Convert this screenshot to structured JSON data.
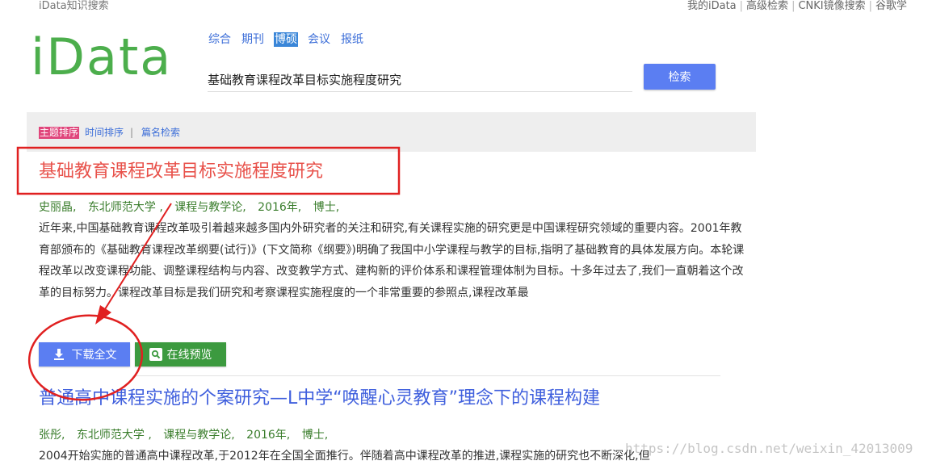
{
  "topbar": {
    "site_name": "iData知识搜索",
    "links": [
      "我的iData",
      "高级检索",
      "CNKI镜像搜索",
      "谷歌学"
    ]
  },
  "logo": {
    "text": "iData"
  },
  "tabs": [
    {
      "label": "综合",
      "active": false
    },
    {
      "label": "期刊",
      "active": false
    },
    {
      "label": "博硕",
      "active": true
    },
    {
      "label": "会议",
      "active": false
    },
    {
      "label": "报纸",
      "active": false
    }
  ],
  "search": {
    "value": "基础教育课程改革目标实施程度研究",
    "button_label": "检索"
  },
  "sort": {
    "topic": "主题排序",
    "time": "时间排序",
    "separator": "|",
    "title": "篇名检索"
  },
  "results": [
    {
      "title": "基础教育课程改革目标实施程度研究",
      "author": "史丽晶,",
      "school": "东北师范大学 ,",
      "subject": "课程与教学论,",
      "year": "2016年,",
      "degree": "博士,",
      "abstract": "近年来,中国基础教育课程改革吸引着越来越多国内外研究者的关注和研究,有关课程实施的研究更是中国课程研究领域的重要内容。2001年教育部颁布的《基础教育课程改革纲要(试行)》(下文简称《纲要》)明确了我国中小学课程与教学的目标,指明了基础教育的具体发展方向。本轮课程改革以改变课程功能、调整课程结构与内容、改变教学方式、建构新的评价体系和课程管理体制为目标。十多年过去了,我们一直朝着这个改革的目标努力。课程改革目标是我们研究和考察课程实施程度的一个非常重要的参照点,课程改革最",
      "download_label": "下载全文",
      "preview_label": "在线预览"
    },
    {
      "title": "普通高中课程实施的个案研究—L中学“唤醒心灵教育”理念下的课程构建",
      "author": "张彤,",
      "school": "东北师范大学 ,",
      "subject": "课程与教学论,",
      "year": "2016年,",
      "degree": "博士,",
      "abstract": "2004开始实施的普通高中课程改革,于2012年在全国全面推行。伴随着高中课程改革的推进,课程实施的研究也不断深化,但"
    }
  ],
  "watermark": "https://blog.csdn.net/weixin_42013009",
  "colors": {
    "logo": "#4cae4c",
    "primary_button": "#5b7ef2",
    "preview_button": "#3c9a3f",
    "title_red": "#e8524b",
    "title_blue": "#3f5fdd",
    "meta_green": "#3a7d2c",
    "annotation_red": "#e02020"
  }
}
